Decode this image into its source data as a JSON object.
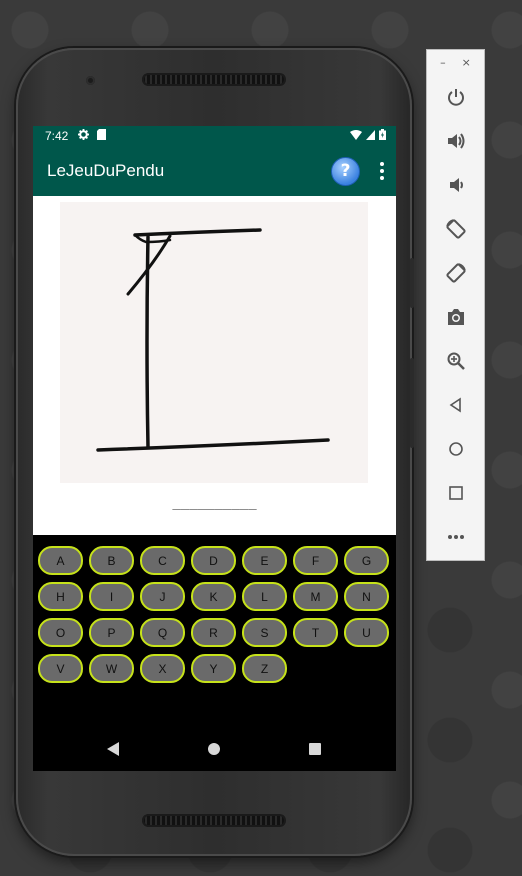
{
  "status_bar": {
    "time": "7:42"
  },
  "app_bar": {
    "title": "LeJeuDuPendu",
    "help_label": "?"
  },
  "game": {
    "word_display": "__________"
  },
  "keyboard": {
    "rows": [
      [
        "A",
        "B",
        "C",
        "D",
        "E",
        "F",
        "G"
      ],
      [
        "H",
        "I",
        "J",
        "K",
        "L",
        "M",
        "N"
      ],
      [
        "O",
        "P",
        "Q",
        "R",
        "S",
        "T",
        "U"
      ],
      [
        "V",
        "W",
        "X",
        "Y",
        "Z"
      ]
    ]
  },
  "emulator": {
    "minimize_label": "–",
    "close_label": "×",
    "tools": [
      "power-icon",
      "volume-up-icon",
      "volume-down-icon",
      "rotate-left-icon",
      "rotate-right-icon",
      "camera-icon",
      "zoom-icon",
      "back-icon",
      "home-icon",
      "overview-icon",
      "more-icon"
    ]
  },
  "colors": {
    "app_bar": "#00574b",
    "key_fill": "#6a6a6a",
    "key_border": "#c6e21a"
  }
}
